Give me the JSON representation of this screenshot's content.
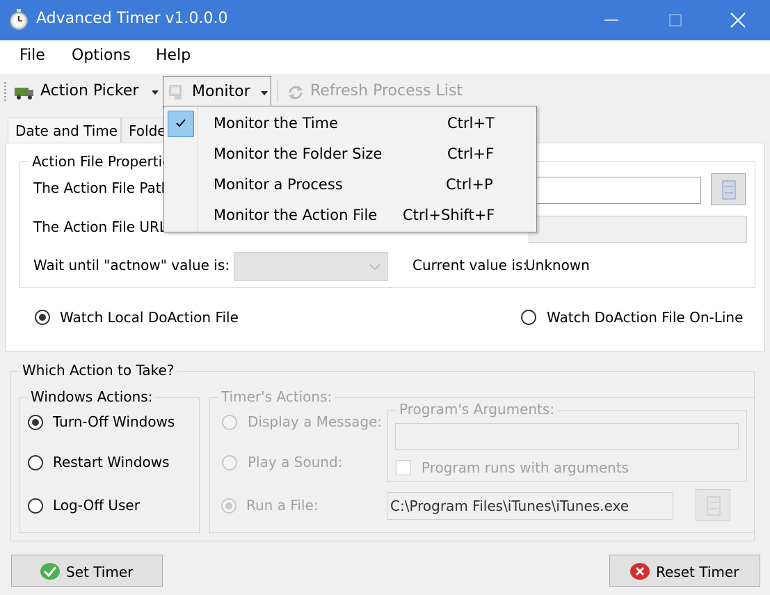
{
  "window": {
    "title": "Advanced Timer v1.0.0.0"
  },
  "menu": {
    "file": "File",
    "options": "Options",
    "help": "Help"
  },
  "toolbar": {
    "action_picker": "Action Picker",
    "monitor": "Monitor",
    "refresh": "Refresh Process List"
  },
  "tabs": [
    "Date and Time",
    "Folde"
  ],
  "monitor_menu": {
    "items": [
      {
        "label": "Monitor the Time",
        "shortcut": "Ctrl+T",
        "checked": true
      },
      {
        "label": "Monitor the Folder Size",
        "shortcut": "Ctrl+F",
        "checked": false
      },
      {
        "label": "Monitor a Process",
        "shortcut": "Ctrl+P",
        "checked": false
      },
      {
        "label": "Monitor the Action File",
        "shortcut": "Ctrl+Shift+F",
        "checked": false
      }
    ]
  },
  "action_file": {
    "group_label": "Action File Propertie",
    "path_label": "The Action File Path",
    "path_value": "",
    "url_label": "The Action File URL",
    "url_value": "",
    "wait_label": "Wait until \"actnow\" value is:",
    "wait_value": "",
    "current_label": "Current value is:",
    "current_value": "Unknown",
    "watch_local": "Watch Local DoAction File",
    "watch_online": "Watch DoAction File On-Line",
    "selected_watch": "local"
  },
  "actions": {
    "group_label": "Which Action to Take?",
    "windows": {
      "label": "Windows Actions:",
      "options": [
        "Turn-Off Windows",
        "Restart Windows",
        "Log-Off User"
      ],
      "selected": "Turn-Off Windows"
    },
    "timer": {
      "label": "Timer's Actions:",
      "options": [
        "Display a Message:",
        "Play a Sound:",
        "Run a File:"
      ],
      "selected": "Run a File:",
      "args_label": "Program's Arguments:",
      "args_value": "",
      "args_check_label": "Program runs with arguments",
      "run_file_path": "C:\\Program Files\\iTunes\\iTunes.exe"
    }
  },
  "buttons": {
    "set": "Set Timer",
    "reset": "Reset Timer"
  },
  "colors": {
    "titlebar": "#3c7bd8",
    "highlight": "#cce4f7",
    "check_box": "#99c9ef"
  }
}
